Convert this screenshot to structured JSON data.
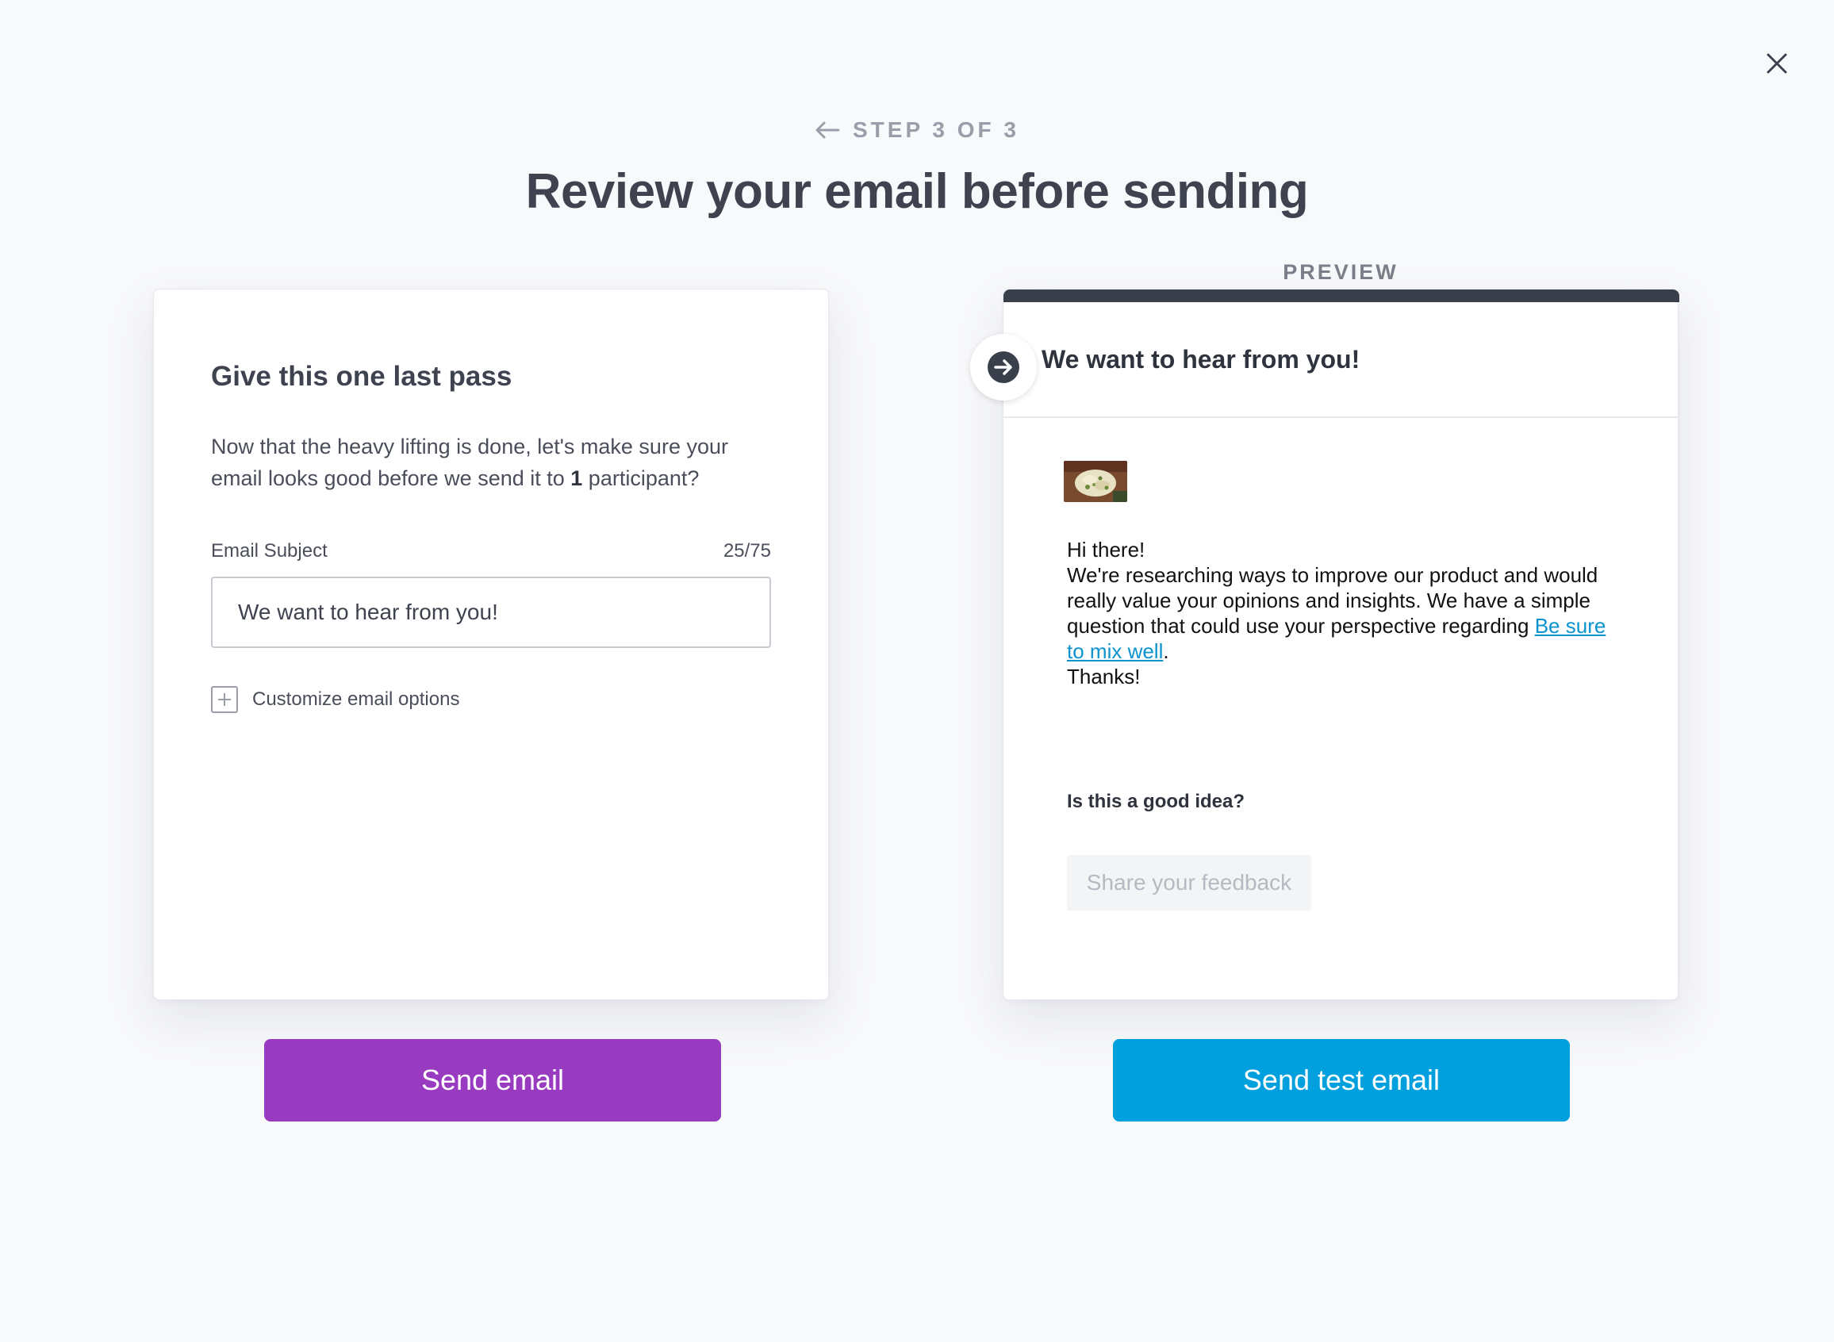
{
  "header": {
    "step": "STEP 3 OF 3",
    "title": "Review your email before sending"
  },
  "editor": {
    "heading": "Give this one last pass",
    "description_before": "Now that the heavy lifting is done, let's make sure your email looks good before we send it to ",
    "description_count": "1",
    "description_after": " participant?",
    "subject_label": "Email Subject",
    "subject_count": "25/75",
    "subject_value": "We want to hear from you!",
    "customize_label": "Customize email options"
  },
  "preview": {
    "label": "PREVIEW",
    "subject": "We want to hear from you!",
    "greeting": "Hi there!",
    "body_text": "We're researching ways to improve our product and would really value your opinions and insights. We have a simple question that could use your perspective regarding ",
    "body_link": "Be sure to mix well",
    "body_end": ".",
    "sign_off": "Thanks!",
    "question": "Is this a good idea?",
    "feedback_button": "Share your feedback"
  },
  "actions": {
    "send": "Send email",
    "send_test": "Send test email"
  },
  "colors": {
    "send_button": "#983bc1",
    "test_button": "#009fdd",
    "link": "#0b93d0",
    "preview_bar": "#3a3f4c"
  },
  "icons": {
    "close": "close-icon",
    "back": "arrow-left-icon",
    "plus": "plus-icon",
    "subject_badge": "arrow-right-circle-icon",
    "thumbnail": "food-image-thumbnail"
  }
}
